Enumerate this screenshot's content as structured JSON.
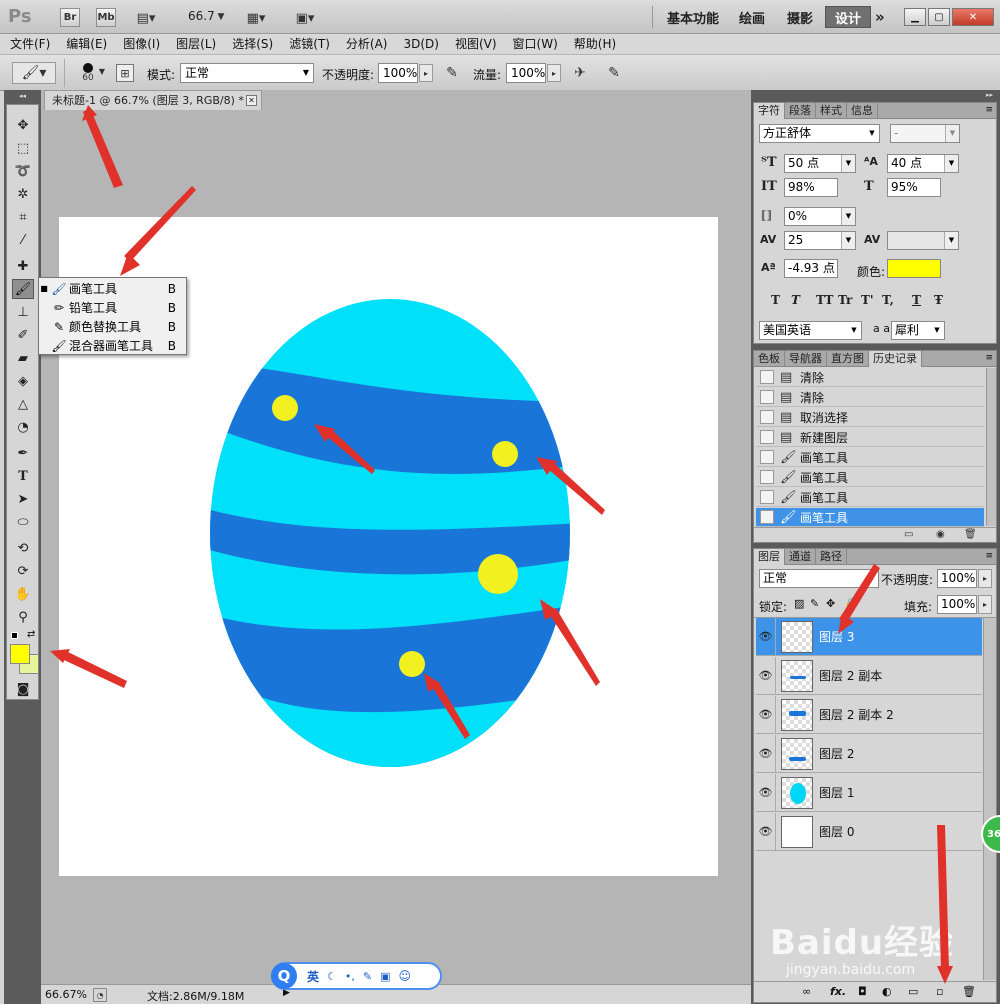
{
  "appbar": {
    "logo": "Ps",
    "br": "Br",
    "mb": "Mb",
    "zoom": "66.7",
    "workspaces": [
      "基本功能",
      "绘画",
      "摄影",
      "设计"
    ],
    "overflow": "»"
  },
  "menu": [
    "文件(F)",
    "编辑(E)",
    "图像(I)",
    "图层(L)",
    "选择(S)",
    "滤镜(T)",
    "分析(A)",
    "3D(D)",
    "视图(V)",
    "窗口(W)",
    "帮助(H)"
  ],
  "options": {
    "brush_size": "60",
    "mode_label": "模式:",
    "mode_value": "正常",
    "opacity_label": "不透明度:",
    "opacity_value": "100%",
    "flow_label": "流量:",
    "flow_value": "100%"
  },
  "document": {
    "tab_title": "未标题-1 @ 66.7% (图层 3, RGB/8) *",
    "zoom": "66.67%",
    "doc_info": "文档:2.86M/9.18M"
  },
  "flyout": [
    {
      "label": "画笔工具",
      "shortcut": "B",
      "icon": "brush-icon",
      "active": true
    },
    {
      "label": "铅笔工具",
      "shortcut": "B",
      "icon": "pencil-icon",
      "active": false
    },
    {
      "label": "颜色替换工具",
      "shortcut": "B",
      "icon": "color-replace-icon",
      "active": false
    },
    {
      "label": "混合器画笔工具",
      "shortcut": "B",
      "icon": "mixer-brush-icon",
      "active": false
    }
  ],
  "character": {
    "tabs": [
      "字符",
      "段落",
      "样式",
      "信息"
    ],
    "font_family": "方正舒体",
    "font_style": "-",
    "size": "50 点",
    "leading": "40 点",
    "vscale": "98%",
    "hscale": "95%",
    "tsume": "0%",
    "tracking": "25",
    "baseline": "-4.93 点",
    "color_label": "颜色:",
    "color_value": "#ffff00",
    "language": "美国英语",
    "aa_label": "a a",
    "antialias": "犀利",
    "style_buttons": [
      "T",
      "T",
      "TT",
      "Tr",
      "T'",
      "T,",
      "T",
      "Ŧ"
    ]
  },
  "history": {
    "tabs": [
      "色板",
      "导航器",
      "直方图",
      "历史记录"
    ],
    "items": [
      "清除",
      "清除",
      "取消选择",
      "新建图层",
      "画笔工具",
      "画笔工具",
      "画笔工具",
      "画笔工具"
    ],
    "selected_index": 7
  },
  "layers": {
    "tabs": [
      "图层",
      "通道",
      "路径"
    ],
    "blend_mode": "正常",
    "opacity_label": "不透明度:",
    "opacity_value": "100%",
    "lock_label": "锁定:",
    "fill_label": "填充:",
    "fill_value": "100%",
    "items": [
      "图层 3",
      "图层 2 副本",
      "图层 2 副本 2",
      "图层 2",
      "图层 1",
      "图层 0"
    ],
    "selected_index": 0
  },
  "ime": {
    "logo": "Q",
    "lang": "英"
  },
  "badge": "36",
  "watermark": {
    "brand": "Baidu经验",
    "url": "jingyan.baidu.com"
  },
  "colors": {
    "foreground": "#ffff00",
    "background": "#e6f59a",
    "egg_light": "#00e0f8",
    "egg_dark": "#1976d8",
    "dot": "#f3f021",
    "selection": "#3f92e5"
  }
}
